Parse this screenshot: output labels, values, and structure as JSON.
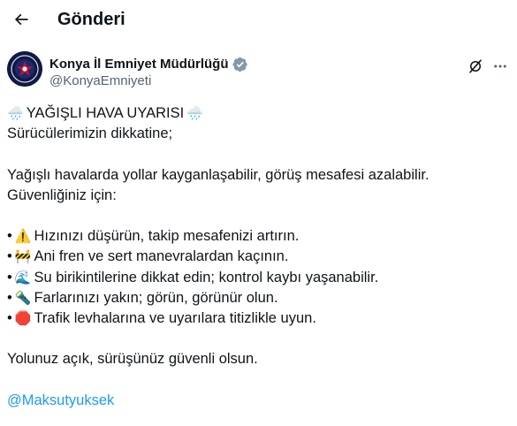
{
  "topbar": {
    "title": "Gönderi"
  },
  "author": {
    "display_name": "Konya İl Emniyet Müdürlüğü",
    "handle": "@KonyaEmniyeti",
    "verified_color": "#829aab"
  },
  "tweet": {
    "title_emoji": "🌧️",
    "title_text": "YAĞIŞLI HAVA UYARISI",
    "line_2": "Sürücülerimizin dikkatine;",
    "line_3": "Yağışlı havalarda yollar kayganlaşabilir, görüş mesafesi azalabilir.",
    "line_4": "Güvenliğiniz için:",
    "items": [
      {
        "bullet": "•",
        "emoji": "⚠️",
        "text": "Hızınızı düşürün, takip mesafenizi artırın."
      },
      {
        "bullet": "•",
        "emoji": "🚧",
        "text": "Ani fren ve sert manevralardan kaçının."
      },
      {
        "bullet": "•",
        "emoji": "🌊",
        "text": "Su birikintilerine dikkat edin; kontrol kaybı yaşanabilir."
      },
      {
        "bullet": "•",
        "emoji": "🔦",
        "text": "Farlarınızı yakın; görün, görünür olun."
      },
      {
        "bullet": "•",
        "emoji": "🛑",
        "text": "Trafik levhalarına ve uyarılara titizlikle uyun."
      }
    ],
    "closing": "Yolunuz açık, sürüşünüz güvenli olsun.",
    "mention": "@Maksutyuksek"
  },
  "icons": {
    "back": "arrow-left-icon",
    "verified": "verified-badge-icon",
    "grok": "grok-icon",
    "more": "more-dots-icon",
    "avatar": "police-emblem"
  },
  "colors": {
    "link": "#1d9bf0",
    "secondary_text": "#536471"
  }
}
